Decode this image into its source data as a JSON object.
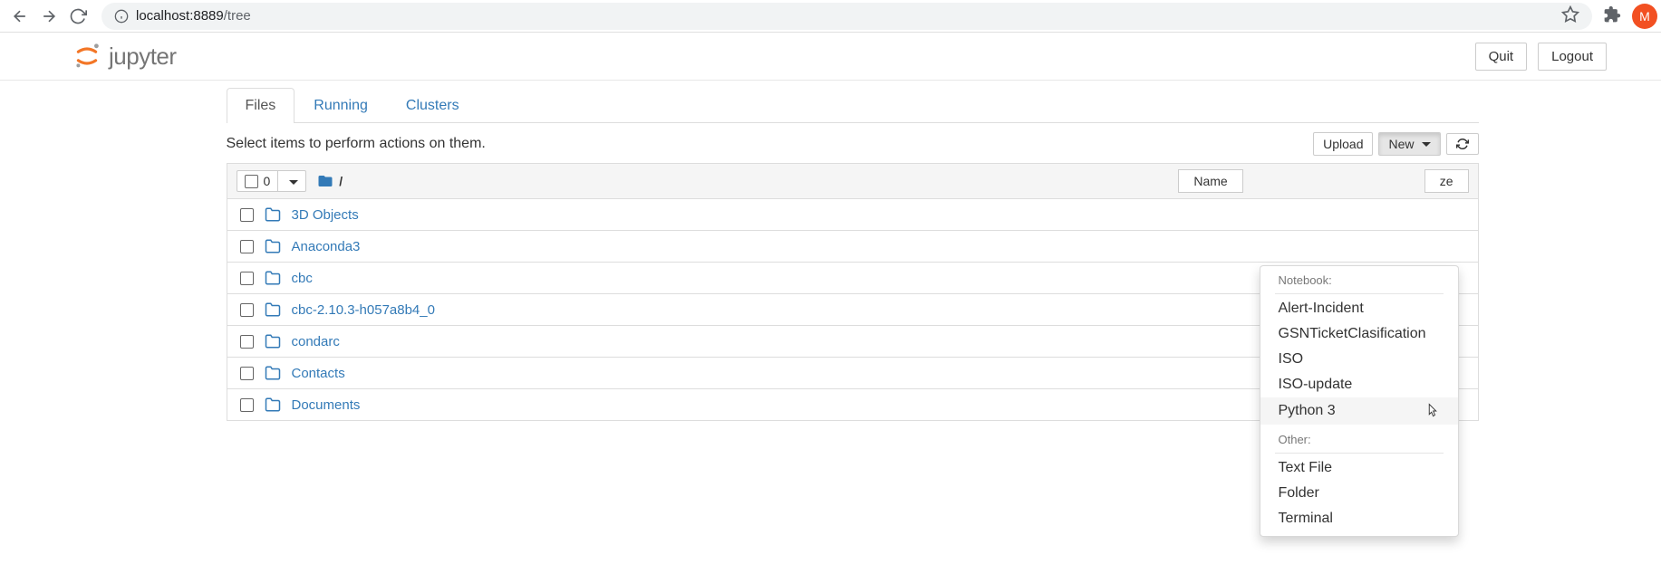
{
  "browser": {
    "url_host": "localhost:8889",
    "url_path": "/tree",
    "avatar_letter": "M"
  },
  "header": {
    "logo_text": "jupyter",
    "quit_label": "Quit",
    "logout_label": "Logout"
  },
  "tabs": [
    {
      "label": "Files",
      "active": true
    },
    {
      "label": "Running",
      "active": false
    },
    {
      "label": "Clusters",
      "active": false
    }
  ],
  "toolbar": {
    "instruction": "Select items to perform actions on them.",
    "upload_label": "Upload",
    "new_label": "New",
    "selected_count": "0",
    "breadcrumb_root": "/"
  },
  "columns": {
    "name": "Name",
    "size_partial": "ze"
  },
  "files": [
    {
      "name": "3D Objects"
    },
    {
      "name": "Anaconda3"
    },
    {
      "name": "cbc"
    },
    {
      "name": "cbc-2.10.3-h057a8b4_0"
    },
    {
      "name": "condarc"
    },
    {
      "name": "Contacts"
    },
    {
      "name": "Documents"
    }
  ],
  "new_menu": {
    "notebook_header": "Notebook:",
    "notebook_items": [
      "Alert-Incident",
      "GSNTicketClasification",
      "ISO",
      "ISO-update",
      "Python 3"
    ],
    "other_header": "Other:",
    "other_items": [
      "Text File",
      "Folder",
      "Terminal"
    ],
    "hovered": "Python 3"
  }
}
